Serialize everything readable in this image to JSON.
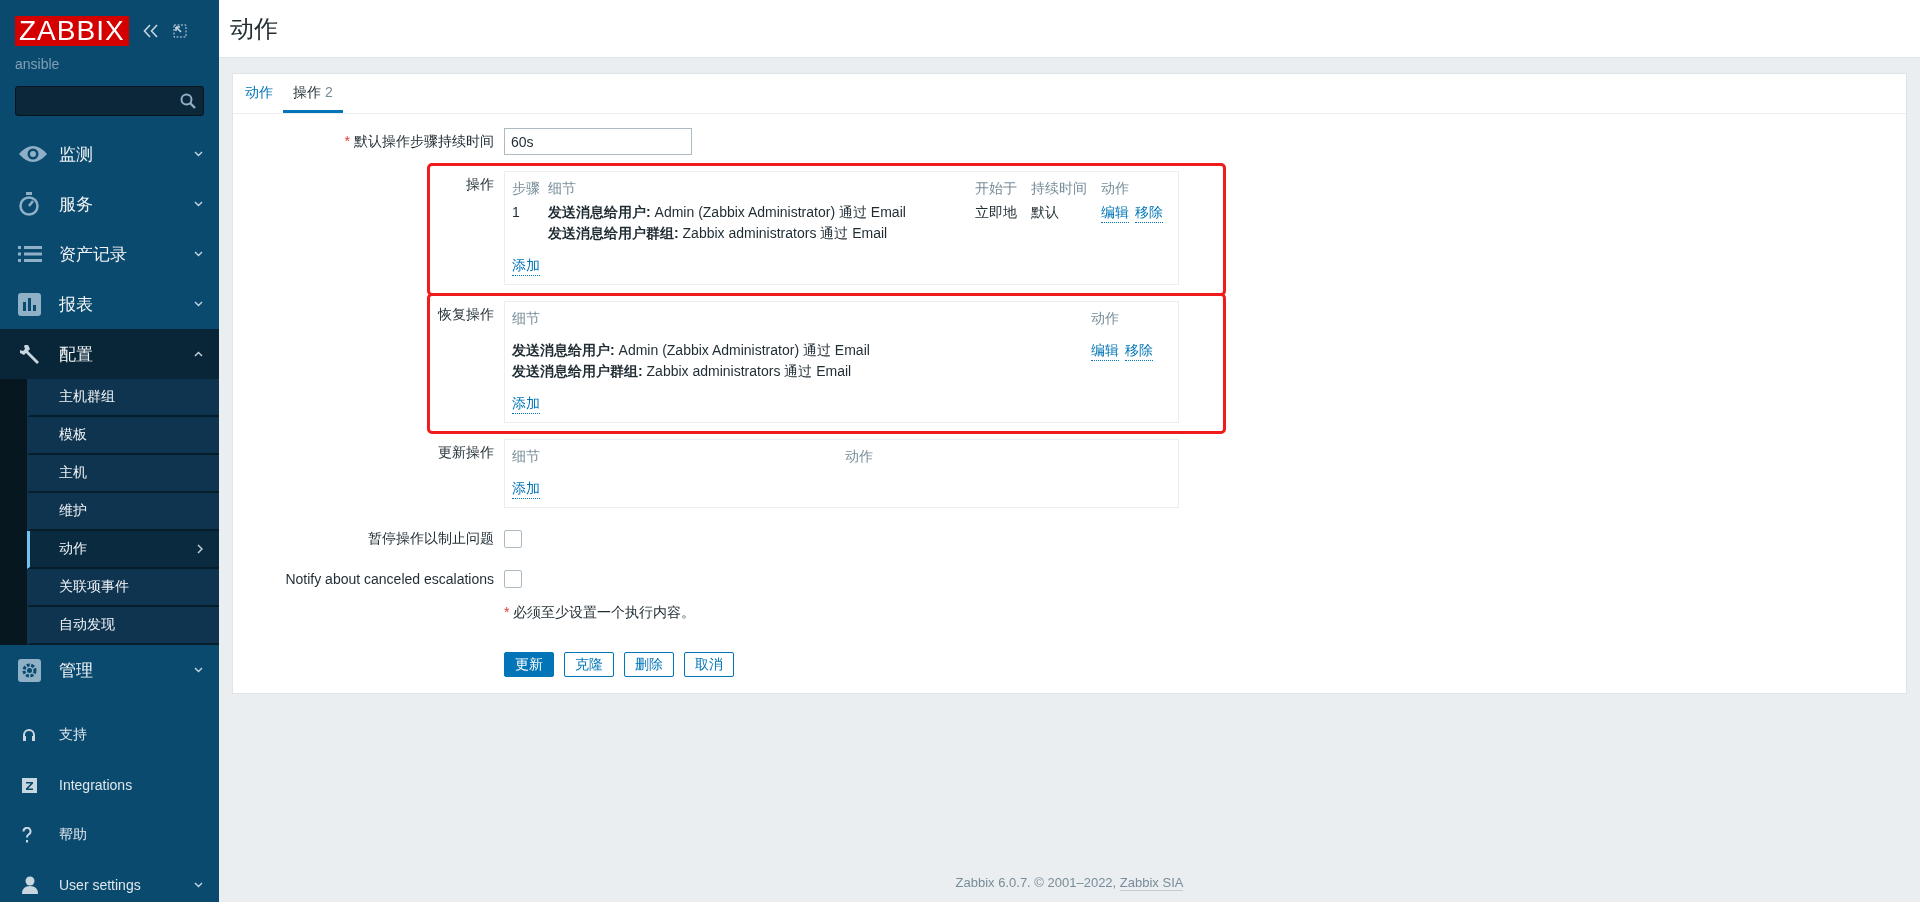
{
  "sidebar": {
    "logo": "ZABBIX",
    "server_name": "ansible",
    "menu": [
      {
        "label": "监测",
        "expanded": false
      },
      {
        "label": "服务",
        "expanded": false
      },
      {
        "label": "资产记录",
        "expanded": false
      },
      {
        "label": "报表",
        "expanded": false
      },
      {
        "label": "配置",
        "expanded": true,
        "children": [
          {
            "label": "主机群组",
            "selected": false
          },
          {
            "label": "模板",
            "selected": false
          },
          {
            "label": "主机",
            "selected": false
          },
          {
            "label": "维护",
            "selected": false
          },
          {
            "label": "动作",
            "selected": true
          },
          {
            "label": "关联项事件",
            "selected": false
          },
          {
            "label": "自动发现",
            "selected": false
          }
        ]
      },
      {
        "label": "管理",
        "expanded": false
      }
    ],
    "footer_menu": [
      {
        "label": "支持"
      },
      {
        "label": "Integrations"
      },
      {
        "label": "帮助"
      },
      {
        "label": "User settings",
        "expanded": false
      }
    ]
  },
  "page": {
    "title": "动作",
    "tabs": [
      {
        "label": "动作",
        "selected": false
      },
      {
        "label": "操作",
        "count": "2",
        "selected": true
      }
    ],
    "step_duration": {
      "marker": "*",
      "label": "默认操作步骤持续时间",
      "value": "60s"
    },
    "sections": [
      {
        "kind": "steps",
        "label": "操作",
        "highlighted": true,
        "columns": [
          "步骤",
          "细节",
          "开始于",
          "持续时间",
          "动作"
        ],
        "rows": [
          {
            "step": "1",
            "details": [
              "**发送消息给用户:** Admin (Zabbix Administrator) 通过 Email",
              "**发送消息给用户群组:** Zabbix administrators 通过 Email"
            ],
            "start": "立即地",
            "duration": "默认",
            "actions": [
              "编辑",
              "移除"
            ]
          }
        ],
        "add": "添加"
      },
      {
        "kind": "details",
        "label": "恢复操作",
        "highlighted": true,
        "columns": [
          "细节",
          "动作"
        ],
        "rows": [
          {
            "details": [
              "**发送消息给用户:** Admin (Zabbix Administrator) 通过 Email",
              "**发送消息给用户群组:** Zabbix administrators 通过 Email"
            ],
            "actions": [
              "编辑",
              "移除"
            ]
          }
        ],
        "add": "添加"
      },
      {
        "kind": "details",
        "label": "更新操作",
        "highlighted": false,
        "columns": [
          "细节",
          "动作"
        ],
        "add": "添加"
      }
    ],
    "checkboxes": [
      {
        "label": "暂停操作以制止问题",
        "checked": false
      },
      {
        "label": "Notify about canceled escalations",
        "checked": false
      }
    ],
    "required_note": {
      "marker": "*",
      "text": "必须至少设置一个执行内容。"
    },
    "buttons": [
      {
        "label": "更新",
        "kind": "primary"
      },
      {
        "label": "克隆",
        "kind": "secondary"
      },
      {
        "label": "删除",
        "kind": "secondary"
      },
      {
        "label": "取消",
        "kind": "secondary"
      }
    ]
  },
  "footer": {
    "text": "Zabbix 6.0.7. © 2001–2022,",
    "link": "Zabbix SIA"
  }
}
